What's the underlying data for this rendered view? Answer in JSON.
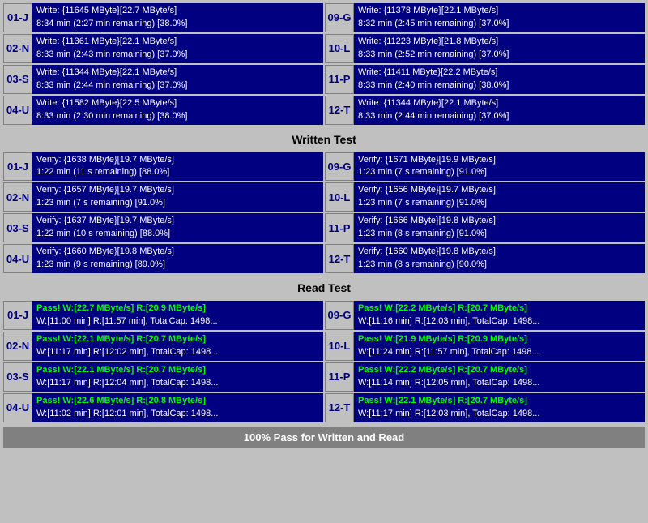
{
  "sections": {
    "write_test": {
      "rows_left": [
        {
          "id": "01-J",
          "line1": "Write: {11645 MByte}[22.7 MByte/s]",
          "line2": "8:34 min (2:27 min remaining)  [38.0%]"
        },
        {
          "id": "02-N",
          "line1": "Write: {11361 MByte}[22.1 MByte/s]",
          "line2": "8:33 min (2:43 min remaining)  [37.0%]"
        },
        {
          "id": "03-S",
          "line1": "Write: {11344 MByte}[22.1 MByte/s]",
          "line2": "8:33 min (2:44 min remaining)  [37.0%]"
        },
        {
          "id": "04-U",
          "line1": "Write: {11582 MByte}[22.5 MByte/s]",
          "line2": "8:33 min (2:30 min remaining)  [38.0%]"
        }
      ],
      "rows_right": [
        {
          "id": "09-G",
          "line1": "Write: {11378 MByte}[22.1 MByte/s]",
          "line2": "8:32 min (2:45 min remaining)  [37.0%]"
        },
        {
          "id": "10-L",
          "line1": "Write: {11223 MByte}[21.8 MByte/s]",
          "line2": "8:33 min (2:52 min remaining)  [37.0%]"
        },
        {
          "id": "11-P",
          "line1": "Write: {11411 MByte}[22.2 MByte/s]",
          "line2": "8:33 min (2:40 min remaining)  [38.0%]"
        },
        {
          "id": "12-T",
          "line1": "Write: {11344 MByte}[22.1 MByte/s]",
          "line2": "8:33 min (2:44 min remaining)  [37.0%]"
        }
      ],
      "header": "Written Test"
    },
    "verify_test": {
      "rows_left": [
        {
          "id": "01-J",
          "line1": "Verify: {1638 MByte}[19.7 MByte/s]",
          "line2": "1:22 min (11 s remaining)   [88.0%]"
        },
        {
          "id": "02-N",
          "line1": "Verify: {1657 MByte}[19.7 MByte/s]",
          "line2": "1:23 min (7 s remaining)   [91.0%]"
        },
        {
          "id": "03-S",
          "line1": "Verify: {1637 MByte}[19.7 MByte/s]",
          "line2": "1:22 min (10 s remaining)   [88.0%]"
        },
        {
          "id": "04-U",
          "line1": "Verify: {1660 MByte}[19.8 MByte/s]",
          "line2": "1:23 min (9 s remaining)   [89.0%]"
        }
      ],
      "rows_right": [
        {
          "id": "09-G",
          "line1": "Verify: {1671 MByte}[19.9 MByte/s]",
          "line2": "1:23 min (7 s remaining)   [91.0%]"
        },
        {
          "id": "10-L",
          "line1": "Verify: {1656 MByte}[19.7 MByte/s]",
          "line2": "1:23 min (7 s remaining)   [91.0%]"
        },
        {
          "id": "11-P",
          "line1": "Verify: {1666 MByte}[19.8 MByte/s]",
          "line2": "1:23 min (8 s remaining)   [91.0%]"
        },
        {
          "id": "12-T",
          "line1": "Verify: {1660 MByte}[19.8 MByte/s]",
          "line2": "1:23 min (8 s remaining)   [90.0%]"
        }
      ],
      "header": "Read Test"
    },
    "read_test": {
      "rows_left": [
        {
          "id": "01-J",
          "line1": "Pass! W:[22.7 MByte/s] R:[20.9 MByte/s]",
          "line2": "W:[11:00 min] R:[11:57 min], TotalCap: 1498..."
        },
        {
          "id": "02-N",
          "line1": "Pass! W:[22.1 MByte/s] R:[20.7 MByte/s]",
          "line2": "W:[11:17 min] R:[12:02 min], TotalCap: 1498..."
        },
        {
          "id": "03-S",
          "line1": "Pass! W:[22.1 MByte/s] R:[20.7 MByte/s]",
          "line2": "W:[11:17 min] R:[12:04 min], TotalCap: 1498..."
        },
        {
          "id": "04-U",
          "line1": "Pass! W:[22.6 MByte/s] R:[20.8 MByte/s]",
          "line2": "W:[11:02 min] R:[12:01 min], TotalCap: 1498..."
        }
      ],
      "rows_right": [
        {
          "id": "09-G",
          "line1": "Pass! W:[22.2 MByte/s] R:[20.7 MByte/s]",
          "line2": "W:[11:16 min] R:[12:03 min], TotalCap: 1498..."
        },
        {
          "id": "10-L",
          "line1": "Pass! W:[21.9 MByte/s] R:[20.9 MByte/s]",
          "line2": "W:[11:24 min] R:[11:57 min], TotalCap: 1498..."
        },
        {
          "id": "11-P",
          "line1": "Pass! W:[22.2 MByte/s] R:[20.7 MByte/s]",
          "line2": "W:[11:14 min] R:[12:05 min], TotalCap: 1498..."
        },
        {
          "id": "12-T",
          "line1": "Pass! W:[22.1 MByte/s] R:[20.7 MByte/s]",
          "line2": "W:[11:17 min] R:[12:03 min], TotalCap: 1498..."
        }
      ]
    },
    "bottom_status": "100% Pass for Written and Read"
  }
}
